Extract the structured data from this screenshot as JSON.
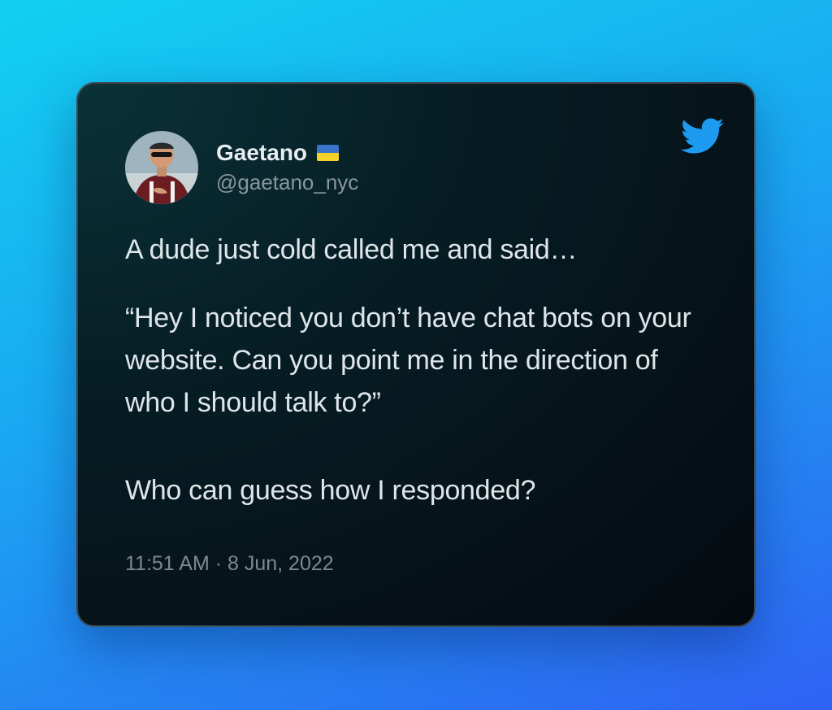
{
  "author": {
    "name": "Gaetano",
    "handle": "@gaetano_nyc",
    "flag": "ukraine-flag-icon"
  },
  "brand_icon": "twitter-bird-icon",
  "tweet": {
    "paragraph_1": "A dude just cold called me and said…",
    "paragraph_2": "“Hey I noticed you don’t have chat bots on your website. Can you point me in the direction of who I should talk to?”",
    "paragraph_3": "Who can guess how I responded?"
  },
  "timestamp": "11:51 AM · 8 Jun, 2022",
  "colors": {
    "twitter_blue": "#1d9bf0",
    "card_background": "#061d24",
    "text": "#dfe6ea",
    "muted_text": "#8a969f"
  }
}
